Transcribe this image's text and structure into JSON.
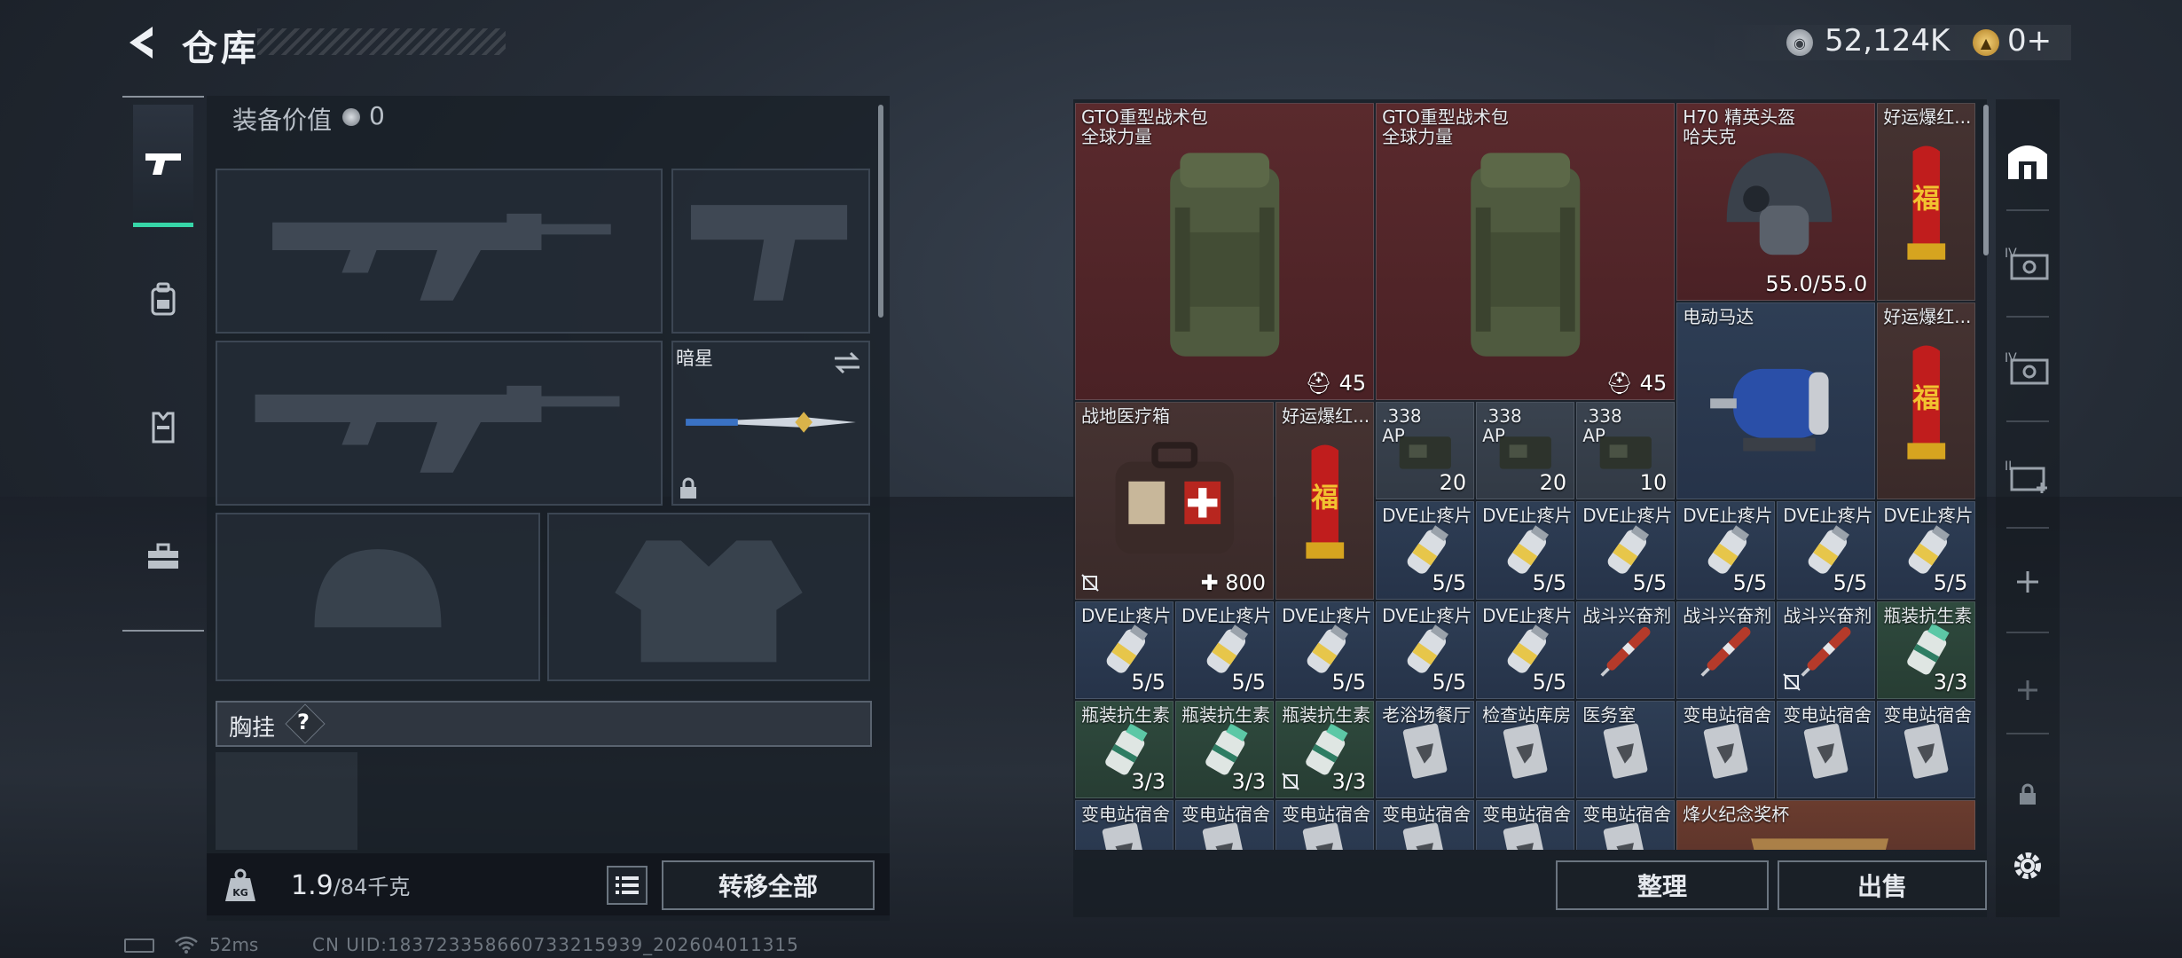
{
  "header": {
    "title": "仓库",
    "cash": "52,124K",
    "gold": "0+"
  },
  "equipment": {
    "value_label": "装备价值",
    "value": "0",
    "melee_name": "暗星",
    "chest_label": "胸挂",
    "chest_help": "?",
    "weight_current": "1.9",
    "weight_max": "/84千克",
    "transfer_all": "转移全部"
  },
  "stash": {
    "items": [
      {
        "name": "GTO重型战术包",
        "sub": "全球力量",
        "count": "45",
        "color": "red"
      },
      {
        "name": "GTO重型战术包",
        "sub": "全球力量",
        "count": "45",
        "color": "red"
      },
      {
        "name": "H70 精英头盔",
        "sub": "哈夫克",
        "count": "55.0/55.0",
        "color": "red"
      },
      {
        "name": "好运爆红...",
        "sub": "",
        "count": "",
        "color": "brown"
      },
      {
        "name": "电动马达",
        "sub": "",
        "count": "",
        "color": "blue"
      },
      {
        "name": "好运爆红...",
        "sub": "",
        "count": "",
        "color": "brown"
      },
      {
        "name": "战地医疗箱",
        "sub": "",
        "count": "800",
        "color": "brown"
      },
      {
        "name": "好运爆红...",
        "sub": "",
        "count": "",
        "color": "brown"
      },
      {
        "name": ".338",
        "sub": "AP",
        "count": "20",
        "color": "gray"
      },
      {
        "name": ".338",
        "sub": "AP",
        "count": "20",
        "color": "gray"
      },
      {
        "name": ".338",
        "sub": "AP",
        "count": "10",
        "color": "gray"
      },
      {
        "name": "DVE止疼片",
        "sub": "",
        "count": "5/5",
        "color": "blue"
      },
      {
        "name": "战斗兴奋剂",
        "sub": "",
        "count": "",
        "color": "blue"
      },
      {
        "name": "瓶装抗生素",
        "sub": "",
        "count": "3/3",
        "color": "green"
      },
      {
        "name": "老浴场餐厅",
        "sub": "",
        "count": "",
        "color": "blue"
      },
      {
        "name": "检查站库房",
        "sub": "",
        "count": "",
        "color": "blue"
      },
      {
        "name": "医务室",
        "sub": "",
        "count": "",
        "color": "blue"
      },
      {
        "name": "变电站宿舍",
        "sub": "",
        "count": "",
        "color": "blue"
      },
      {
        "name": "烽火纪念奖杯",
        "sub": "",
        "count": "",
        "color": "gold"
      }
    ],
    "sort": "整理",
    "sell": "出售"
  },
  "status": {
    "ping": "52ms",
    "uid": "CN UID:183723358660733215939_202604011315"
  },
  "icons": [
    "back-arrow-icon",
    "silver-coin-icon",
    "gold-coin-icon",
    "pistol-icon",
    "backpack-icon",
    "vest-icon",
    "toolbox-icon",
    "swap-icon",
    "lock-icon",
    "weight-icon",
    "list-icon",
    "home-icon",
    "safe-box-icon",
    "plus-icon",
    "gear-icon",
    "no-insure-icon"
  ]
}
